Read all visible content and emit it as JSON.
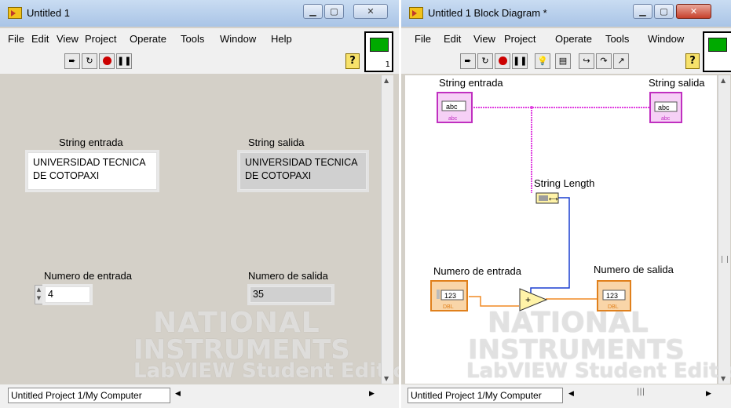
{
  "front_panel": {
    "title": "Untitled 1",
    "menu": [
      "File",
      "Edit",
      "View",
      "Project",
      "Operate",
      "Tools",
      "Window",
      "Help"
    ],
    "connector_number": "1",
    "string_entrada": {
      "label": "String entrada",
      "line1": "UNIVERSIDAD TECNICA",
      "line2": "DE COTOPAXI"
    },
    "string_salida": {
      "label": "String salida",
      "line1": "UNIVERSIDAD TECNICA",
      "line2": "DE COTOPAXI"
    },
    "numero_entrada": {
      "label": "Numero de entrada",
      "value": "4"
    },
    "numero_salida": {
      "label": "Numero de salida",
      "value": "35"
    },
    "status_path": "Untitled Project 1/My Computer"
  },
  "block_diagram": {
    "title": "Untitled 1 Block Diagram *",
    "menu": [
      "File",
      "Edit",
      "View",
      "Project",
      "Operate",
      "Tools",
      "Window"
    ],
    "labels": {
      "string_entrada": "String entrada",
      "string_salida": "String salida",
      "string_length": "String Length",
      "numero_entrada": "Numero de entrada",
      "numero_salida": "Numero de salida"
    },
    "terminal_text": {
      "abc": "abc",
      "num": "123",
      "dbl": "DBL"
    },
    "status_path": "Untitled Project 1/My Computer"
  },
  "watermark": {
    "line1": "NATIONAL",
    "line2": "INSTRUMENTS",
    "line3": "LabVIEW Student Edition"
  },
  "colors": {
    "string_wire": "#e040e0",
    "number_wire": "#f08a24",
    "int_wire": "#1a3fd0",
    "panel_bg": "#d4d0c8"
  }
}
